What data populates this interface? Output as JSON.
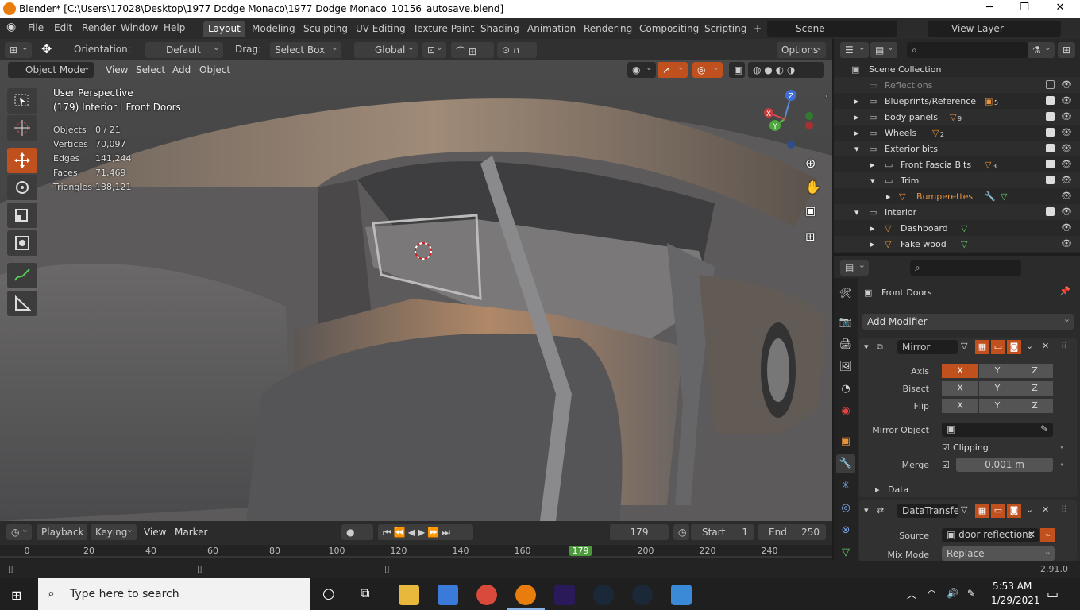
{
  "window": {
    "title": "Blender* [C:\\Users\\17028\\Desktop\\1977 Dodge Monaco\\1977 Dodge Monaco_10156_autosave.blend]"
  },
  "menu": [
    "File",
    "Edit",
    "Render",
    "Window",
    "Help"
  ],
  "workspaces": [
    "Layout",
    "Modeling",
    "Sculpting",
    "UV Editing",
    "Texture Paint",
    "Shading",
    "Animation",
    "Rendering",
    "Compositing",
    "Scripting"
  ],
  "topbar": {
    "scene": "Scene",
    "view_layer": "View Layer"
  },
  "toolheader": {
    "orientation_label": "Orientation:",
    "orientation": "Default",
    "drag_label": "Drag:",
    "drag": "Select Box",
    "transform": "Global",
    "options": "Options"
  },
  "viewport_header": {
    "mode": "Object Mode",
    "items": [
      "View",
      "Select",
      "Add",
      "Object"
    ]
  },
  "overlay": {
    "perspective": "User Perspective",
    "context": "(179) Interior | Front Doors"
  },
  "stats": [
    {
      "label": "Objects",
      "value": "0 / 21"
    },
    {
      "label": "Vertices",
      "value": "70,097"
    },
    {
      "label": "Edges",
      "value": "141,244"
    },
    {
      "label": "Faces",
      "value": "71,469"
    },
    {
      "label": "Triangles",
      "value": "138,121"
    }
  ],
  "gizmo": {
    "x": "X",
    "y": "Y",
    "z": "Z"
  },
  "outliner": {
    "root": "Scene Collection",
    "rows": [
      {
        "label": "Reflections",
        "count": ""
      },
      {
        "label": "Blueprints/Reference",
        "count": "5"
      },
      {
        "label": "body panels",
        "count": "9"
      },
      {
        "label": "Wheels",
        "count": "2"
      },
      {
        "label": "Exterior bits",
        "count": ""
      },
      {
        "label": "Front Fascia Bits",
        "count": "3"
      },
      {
        "label": "Trim",
        "count": ""
      },
      {
        "label": "Bumperettes",
        "count": ""
      },
      {
        "label": "Interior",
        "count": ""
      },
      {
        "label": "Dashboard",
        "count": ""
      },
      {
        "label": "Fake wood",
        "count": ""
      }
    ]
  },
  "properties": {
    "object": "Front Doors",
    "add_modifier": "Add Modifier",
    "mirror": {
      "name": "Mirror",
      "axis_label": "Axis",
      "bisect_label": "Bisect",
      "flip_label": "Flip",
      "x": "X",
      "y": "Y",
      "z": "Z",
      "mirror_object_label": "Mirror Object",
      "clipping": "Clipping",
      "merge_label": "Merge",
      "merge_value": "0.001 m",
      "data": "Data"
    },
    "datatransfer": {
      "name": "DataTransfer",
      "source_label": "Source",
      "source": "door reflections",
      "mix_mode_label": "Mix Mode",
      "mix_mode": "Replace"
    }
  },
  "timeline": {
    "menus": [
      "Playback",
      "Keying",
      "View",
      "Marker"
    ],
    "current_frame": "179",
    "start_label": "Start",
    "start": "1",
    "end_label": "End",
    "end": "250",
    "ticks": [
      "0",
      "20",
      "40",
      "60",
      "80",
      "100",
      "120",
      "140",
      "160",
      "179",
      "200",
      "220",
      "240"
    ]
  },
  "status": {
    "version": "2.91.0"
  },
  "taskbar": {
    "search_placeholder": "Type here to search",
    "time": "5:53 AM",
    "date": "1/29/2021"
  }
}
